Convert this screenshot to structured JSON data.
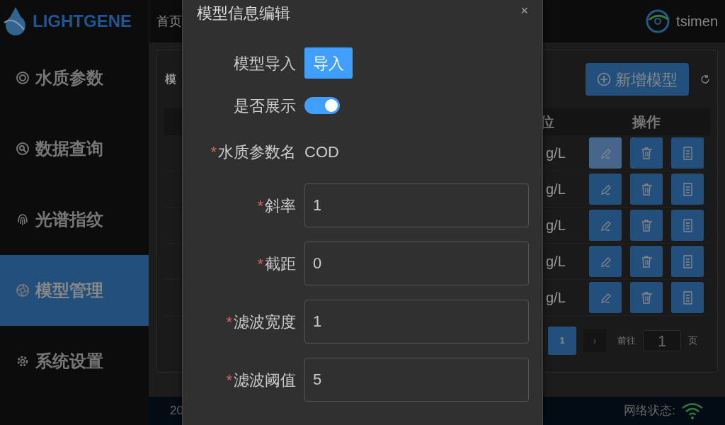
{
  "header": {
    "logo": "LIGHTGENE",
    "breadcrumb": "首页",
    "user": "tsimen"
  },
  "sidebar": {
    "items": [
      {
        "label": "水质参数",
        "selected": false
      },
      {
        "label": "数据查询",
        "selected": false
      },
      {
        "label": "光谱指纹",
        "selected": false
      },
      {
        "label": "模型管理",
        "selected": true
      },
      {
        "label": "系统设置",
        "selected": false
      }
    ]
  },
  "panel": {
    "title": "模",
    "add_button": "新增模型",
    "columns": [
      "位",
      "操作"
    ],
    "rows": [
      {
        "unit": "g/L",
        "highlighted": true
      },
      {
        "unit": "g/L",
        "highlighted": false
      },
      {
        "unit": "g/L",
        "highlighted": false
      },
      {
        "unit": "g/L",
        "highlighted": false
      },
      {
        "unit": "g/L",
        "highlighted": false
      }
    ],
    "pagination": {
      "pages": [
        {
          "label": "1",
          "selected": true
        }
      ],
      "next": "›",
      "goto_label": "前往",
      "goto_value": "1",
      "page_unit": "页"
    }
  },
  "footer": {
    "text": "20",
    "network_label": "网络状态:"
  },
  "dialog": {
    "title": "模型信息编辑",
    "close": "×",
    "fields": [
      {
        "kind": "button",
        "label": "模型导入",
        "button": "导入"
      },
      {
        "kind": "switch",
        "label": "是否展示",
        "on": true
      },
      {
        "kind": "text",
        "label": "水质参数名",
        "required_mark": "*",
        "value": "COD"
      },
      {
        "kind": "input",
        "label": "斜率",
        "required_mark": "*",
        "value": "1"
      },
      {
        "kind": "input",
        "label": "截距",
        "required_mark": "*",
        "value": "0"
      },
      {
        "kind": "input",
        "label": "滤波宽度",
        "required_mark": "*",
        "value": "1"
      },
      {
        "kind": "input",
        "label": "滤波阈值",
        "required_mark": "*",
        "value": "5"
      }
    ]
  }
}
